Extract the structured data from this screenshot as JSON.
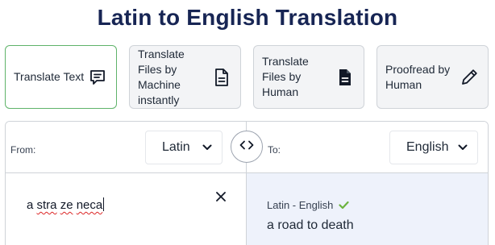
{
  "page": {
    "title": "Latin to English Translation"
  },
  "modes": [
    {
      "label": "Translate Text",
      "icon": "chat-text-icon",
      "active": true
    },
    {
      "label": "Translate Files by Machine instantly",
      "icon": "document-icon",
      "active": false
    },
    {
      "label": "Translate Files by Human",
      "icon": "document-filled-icon",
      "active": false
    },
    {
      "label": "Proofread by Human",
      "icon": "pencil-icon",
      "active": false
    }
  ],
  "source": {
    "prefix": "From:",
    "language": "Latin",
    "words": [
      "a",
      "stra",
      "ze",
      "neca"
    ]
  },
  "target": {
    "prefix": "To:",
    "language": "English",
    "pair_label": "Latin - English",
    "result": "a road to death"
  },
  "colors": {
    "title": "#172554",
    "active_border": "#5fb36a",
    "check": "#6cb33f",
    "target_bg": "#eef2fb"
  }
}
